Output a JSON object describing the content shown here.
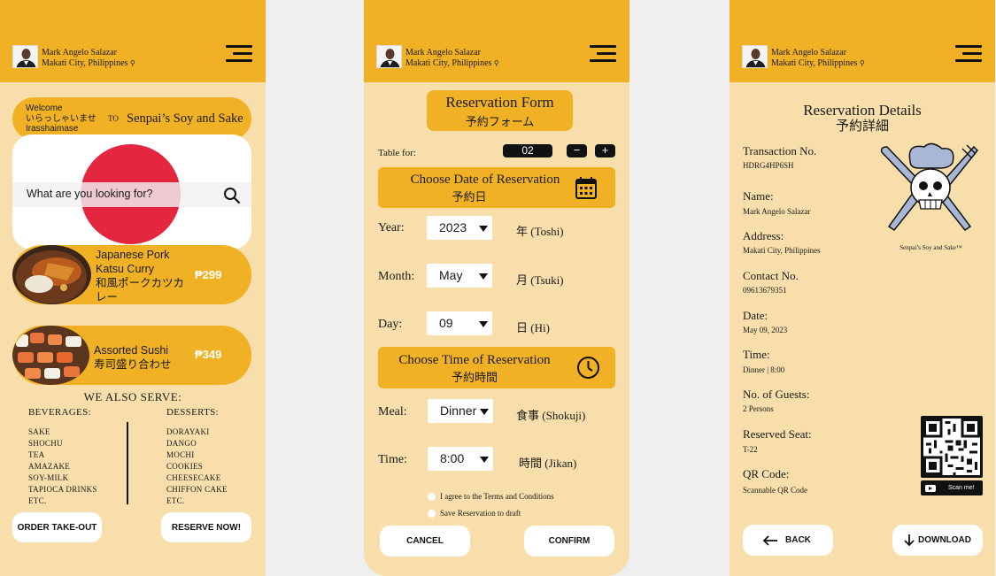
{
  "user": {
    "name": "Mark Angelo Salazar",
    "location": "Makati City, Philippines",
    "location_icon": "pin-icon"
  },
  "colors": {
    "accent": "#f0b125",
    "background": "#f7deaa",
    "flag_red": "#e4263f"
  },
  "home": {
    "welcome_en": "Welcome",
    "welcome_jp": "いらっしゃいませ",
    "welcome_romaji": "Irasshaimase",
    "to": "TO",
    "brand": "Senpai’s Soy and Sake",
    "search_placeholder": "What are you looking for?",
    "items": [
      {
        "name": "Japanese Pork Katsu Curry",
        "name_jp": "和風ポークカツカレー",
        "price": "₱299"
      },
      {
        "name": "Assorted Sushi",
        "name_jp": "寿司盛り合わせ",
        "price": "₱349"
      }
    ],
    "also_serve": "WE ALSO SERVE:",
    "beverages_title": "BEVERAGES:",
    "beverages": [
      "SAKE",
      "SHOCHU",
      "TEA",
      "AMAZAKE",
      "SOY-MILK",
      "TAPIOCA DRINKS",
      "ETC."
    ],
    "desserts_title": "DESSERTS:",
    "desserts": [
      "DORAYAKI",
      "DANGO",
      "MOCHI",
      "COOKIES",
      "CHEESECAKE",
      "CHIFFON CAKE",
      "ETC."
    ],
    "order_btn": "ORDER TAKE-OUT",
    "reserve_btn": "RESERVE NOW!"
  },
  "form": {
    "title": "Reservation Form",
    "title_jp": "予約フォーム",
    "table_for_label": "Table for:",
    "table_for_value": "02",
    "minus": "−",
    "plus": "+",
    "date_section": "Choose Date of Reservation",
    "date_section_jp": "予約日",
    "year_label": "Year:",
    "year_value": "2023",
    "year_jp": "年",
    "year_romaji": "(Toshi)",
    "month_label": "Month:",
    "month_value": "May",
    "month_jp": "月",
    "month_romaji": "(Tsuki)",
    "day_label": "Day:",
    "day_value": "09",
    "day_jp": "日",
    "day_romaji": "(Hi)",
    "time_section": "Choose Time of Reservation",
    "time_section_jp": "予約時間",
    "meal_label": "Meal:",
    "meal_value": "Dinner",
    "meal_jp": "食事",
    "meal_romaji": "(Shokuji)",
    "time_label": "Time:",
    "time_value": "8:00",
    "time_jp": "時間",
    "time_romaji": "(Jikan)",
    "terms": "I agree to the Terms and Conditions",
    "draft": "Save Reservation to draft",
    "cancel": "CANCEL",
    "confirm": "CONFIRM"
  },
  "details": {
    "title": "Reservation Details",
    "title_jp": "予約詳細",
    "fields": [
      {
        "label": "Transaction No.",
        "value": "HDRG4HP6SH"
      },
      {
        "label": "Name:",
        "value": "Mark Angelo Salazar"
      },
      {
        "label": "Address:",
        "value": "Makati City, Philippines"
      },
      {
        "label": "Contact No.",
        "value": "09613679351"
      },
      {
        "label": "Date:",
        "value": "May 09, 2023"
      },
      {
        "label": "Time:",
        "value": "Dinner | 8:00"
      },
      {
        "label": "No. of Guests:",
        "value": "2 Persons"
      },
      {
        "label": "Reserved Seat:",
        "value": "T-22"
      },
      {
        "label": "QR Code:",
        "value": "Scannable QR Code"
      }
    ],
    "brand_caption": "Senpai’s Soy and Sake™",
    "scan": "Scan me!",
    "back": "BACK",
    "download": "DOWNLOAD"
  }
}
